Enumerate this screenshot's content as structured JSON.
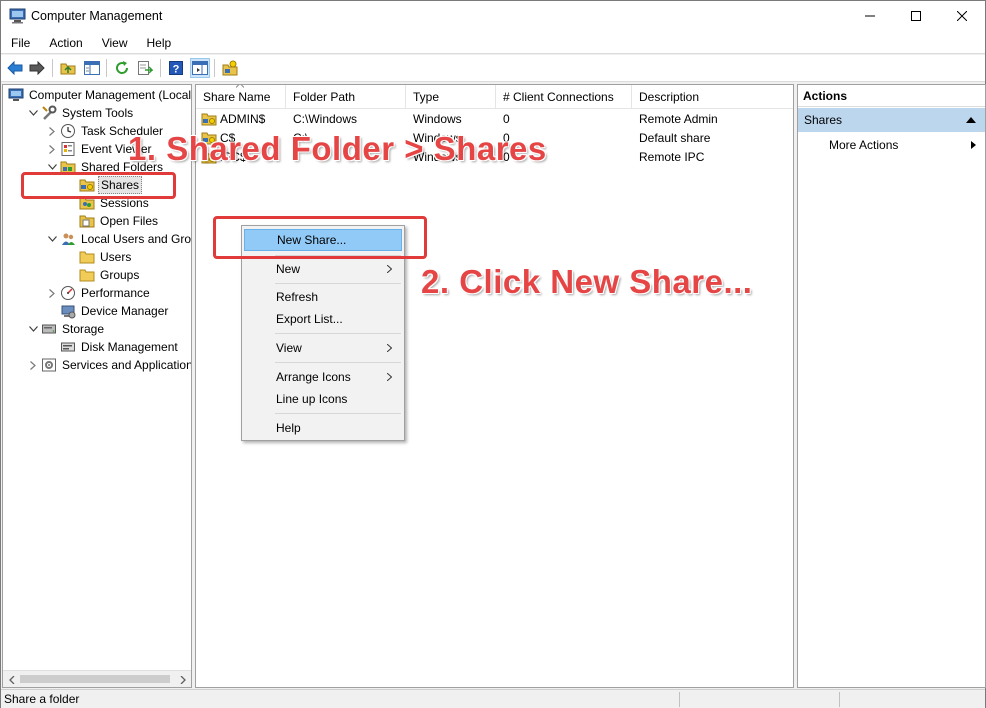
{
  "window": {
    "title": "Computer Management",
    "controls": {
      "minimize": "minimize",
      "maximize": "maximize",
      "close": "close"
    }
  },
  "menubar": [
    "File",
    "Action",
    "View",
    "Help"
  ],
  "toolbar": {
    "icons": [
      "back-arrow-icon",
      "forward-arrow-icon",
      "up-folder-icon",
      "show-hide-tree-icon",
      "refresh-icon",
      "export-list-icon",
      "help-icon",
      "show-hide-action-pane-icon",
      "new-share-icon"
    ]
  },
  "tree": {
    "items": [
      {
        "label": "Computer Management (Local",
        "icon": "computer-icon",
        "level": 0,
        "expander": "none"
      },
      {
        "label": "System Tools",
        "icon": "tools-icon",
        "level": 1,
        "expander": "expanded"
      },
      {
        "label": "Task Scheduler",
        "icon": "clock-icon",
        "level": 2,
        "expander": "collapsed"
      },
      {
        "label": "Event Viewer",
        "icon": "event-viewer-icon",
        "level": 2,
        "expander": "collapsed"
      },
      {
        "label": "Shared Folders",
        "icon": "shared-folder-icon",
        "level": 2,
        "expander": "expanded"
      },
      {
        "label": "Shares",
        "icon": "shares-icon",
        "level": 3,
        "expander": "none",
        "selected": true
      },
      {
        "label": "Sessions",
        "icon": "sessions-icon",
        "level": 3,
        "expander": "none"
      },
      {
        "label": "Open Files",
        "icon": "open-files-icon",
        "level": 3,
        "expander": "none"
      },
      {
        "label": "Local Users and Groups",
        "icon": "users-groups-icon",
        "level": 2,
        "expander": "expanded"
      },
      {
        "label": "Users",
        "icon": "folder-icon",
        "level": 3,
        "expander": "none"
      },
      {
        "label": "Groups",
        "icon": "folder-icon",
        "level": 3,
        "expander": "none"
      },
      {
        "label": "Performance",
        "icon": "performance-icon",
        "level": 2,
        "expander": "collapsed"
      },
      {
        "label": "Device Manager",
        "icon": "device-manager-icon",
        "level": 2,
        "expander": "none"
      },
      {
        "label": "Storage",
        "icon": "storage-icon",
        "level": 1,
        "expander": "expanded"
      },
      {
        "label": "Disk Management",
        "icon": "disk-icon",
        "level": 2,
        "expander": "none"
      },
      {
        "label": "Services and Applications",
        "icon": "services-icon",
        "level": 1,
        "expander": "collapsed"
      }
    ]
  },
  "list": {
    "columns": [
      "Share Name",
      "Folder Path",
      "Type",
      "# Client Connections",
      "Description"
    ],
    "rows": [
      {
        "name": "ADMIN$",
        "path": "C:\\Windows",
        "type": "Windows",
        "connections": "0",
        "description": "Remote Admin"
      },
      {
        "name": "C$",
        "path": "C:\\",
        "type": "Windows",
        "connections": "0",
        "description": "Default share"
      },
      {
        "name": "IPC$",
        "path": "",
        "type": "Windows",
        "connections": "0",
        "description": "Remote IPC"
      }
    ]
  },
  "context_menu": {
    "items": [
      "New Share...",
      "New",
      "Refresh",
      "Export List...",
      "View",
      "Arrange Icons",
      "Line up Icons",
      "Help"
    ]
  },
  "actions": {
    "header": "Actions",
    "section": "Shares",
    "more": "More Actions"
  },
  "status": {
    "text": "Share a folder"
  },
  "annotations": {
    "step1": "1. Shared Folder > Shares",
    "step2": "2. Click New Share...",
    "color": "#e03a3a"
  }
}
